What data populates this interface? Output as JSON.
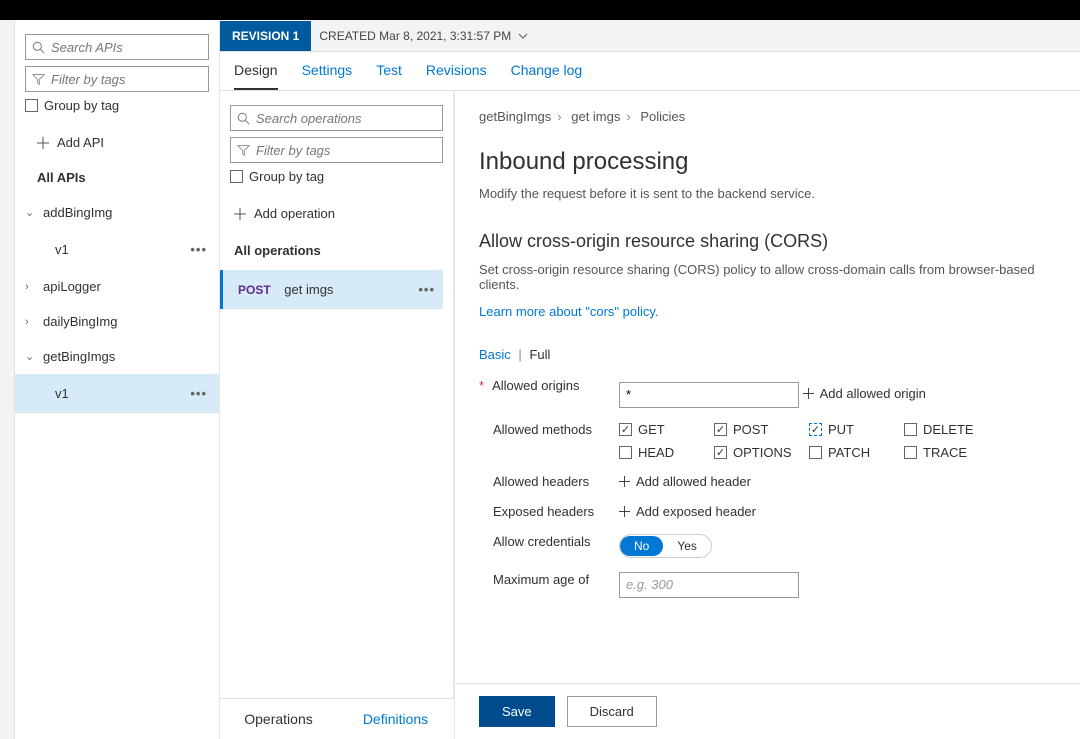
{
  "sidebar": {
    "search_placeholder": "Search APIs",
    "filter_placeholder": "Filter by tags",
    "group_by_label": "Group by tag",
    "add_api_label": "Add API",
    "all_apis_label": "All APIs",
    "items": [
      {
        "label": "addBingImg",
        "expanded": true,
        "children": [
          {
            "label": "v1"
          }
        ]
      },
      {
        "label": "apiLogger",
        "expanded": false
      },
      {
        "label": "dailyBingImg",
        "expanded": false
      },
      {
        "label": "getBingImgs",
        "expanded": true,
        "children": [
          {
            "label": "v1",
            "selected": true
          }
        ]
      }
    ]
  },
  "topbar": {
    "revision_label": "REVISION 1",
    "created_label": "CREATED Mar 8, 2021, 3:31:57 PM",
    "tabs": [
      "Design",
      "Settings",
      "Test",
      "Revisions",
      "Change log"
    ],
    "active_tab": "Design"
  },
  "operations": {
    "search_placeholder": "Search operations",
    "filter_placeholder": "Filter by tags",
    "group_by_label": "Group by tag",
    "add_op_label": "Add operation",
    "all_ops_label": "All operations",
    "items": [
      {
        "method": "POST",
        "name": "get imgs",
        "selected": true
      }
    ],
    "bottom_tabs": {
      "operations": "Operations",
      "definitions": "Definitions"
    }
  },
  "breadcrumb": [
    "getBingImgs",
    "get imgs",
    "Policies"
  ],
  "page": {
    "title": "Inbound processing",
    "desc": "Modify the request before it is sent to the backend service."
  },
  "cors": {
    "title": "Allow cross-origin resource sharing (CORS)",
    "desc": "Set cross-origin resource sharing (CORS) policy to allow cross-domain calls from browser-based clients.",
    "learn_link": "Learn more about \"cors\" policy.",
    "mode_basic": "Basic",
    "mode_full": "Full",
    "allowed_origins_label": "Allowed origins",
    "allowed_origins_value": "*",
    "add_origin_label": "Add allowed origin",
    "allowed_methods_label": "Allowed methods",
    "methods": [
      {
        "name": "GET",
        "checked": true
      },
      {
        "name": "POST",
        "checked": true
      },
      {
        "name": "PUT",
        "checked": true,
        "focus": true
      },
      {
        "name": "DELETE",
        "checked": false
      },
      {
        "name": "HEAD",
        "checked": false
      },
      {
        "name": "OPTIONS",
        "checked": true
      },
      {
        "name": "PATCH",
        "checked": false
      },
      {
        "name": "TRACE",
        "checked": false
      }
    ],
    "allowed_headers_label": "Allowed headers",
    "add_header_label": "Add allowed header",
    "exposed_headers_label": "Exposed headers",
    "add_exposed_label": "Add exposed header",
    "allow_creds_label": "Allow credentials",
    "toggle_no": "No",
    "toggle_yes": "Yes",
    "max_age_label": "Maximum age of",
    "max_age_placeholder": "e.g. 300"
  },
  "footer": {
    "save": "Save",
    "discard": "Discard"
  }
}
